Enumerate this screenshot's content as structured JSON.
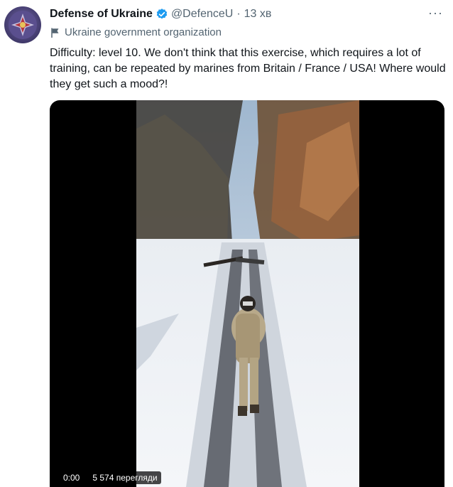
{
  "author": {
    "display_name": "Defense of Ukraine",
    "handle": "@DefenceU",
    "time": "13 хв",
    "label": "Ukraine government organization"
  },
  "tweet": {
    "text": "Difficulty: level 10. We don't think that this exercise, which requires a lot of training, can be repeated by marines from Britain / France / USA! Where would they get such a mood?!"
  },
  "video": {
    "timestamp": "0:00",
    "views": "5 574 перегляди"
  },
  "menu": {
    "more_label": "···"
  },
  "icons": {
    "verified": "verified-badge-icon",
    "label": "flag-icon",
    "more": "more-icon"
  },
  "colors": {
    "accent": "#1d9bf0",
    "secondary_text": "#536471",
    "primary_text": "#0f1419"
  }
}
